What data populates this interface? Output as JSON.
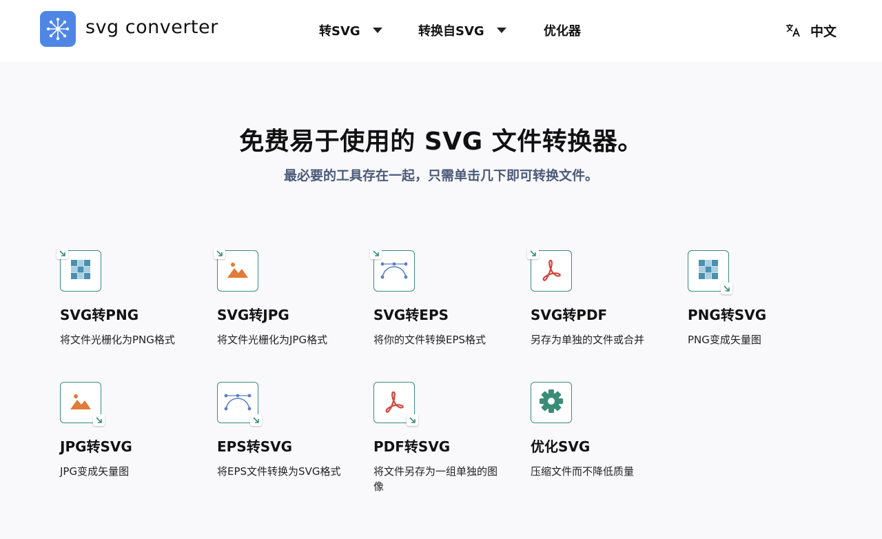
{
  "header": {
    "brand": "svg converter",
    "nav": [
      {
        "label": "转SVG",
        "has_dropdown": true
      },
      {
        "label": "转换自SVG",
        "has_dropdown": true
      },
      {
        "label": "优化器",
        "has_dropdown": false
      }
    ],
    "language": {
      "label": "中文",
      "icon": "translate-icon"
    }
  },
  "hero": {
    "title": "免费易于使用的 SVG 文件转换器。",
    "subtitle": "最必要的工具存在一起，只需单击几下即可转换文件。"
  },
  "colors": {
    "accent": "#3a8c77",
    "logo": "#4f86e6",
    "png_icon": "#4a90b0",
    "jpg_icon": "#e07b39",
    "eps_icon": "#5a7fc4",
    "pdf_icon": "#d0433a",
    "gear_icon": "#3a8c77"
  },
  "tools": [
    {
      "title": "SVG转PNG",
      "desc": "将文件光栅化为PNG格式",
      "icon": "checker-icon",
      "badge": "top-left"
    },
    {
      "title": "SVG转JPG",
      "desc": "将文件光栅化为JPG格式",
      "icon": "mountain-image-icon",
      "badge": "top-left"
    },
    {
      "title": "SVG转EPS",
      "desc": "将你的文件转换EPS格式",
      "icon": "bezier-curve-icon",
      "badge": "top-left"
    },
    {
      "title": "SVG转PDF",
      "desc": "另存为单独的文件或合并",
      "icon": "pdf-icon",
      "badge": "top-left"
    },
    {
      "title": "PNG转SVG",
      "desc": "PNG变成矢量图",
      "icon": "checker-icon",
      "badge": "bottom-right"
    },
    {
      "title": "JPG转SVG",
      "desc": "JPG变成矢量图",
      "icon": "mountain-image-icon",
      "badge": "bottom-right"
    },
    {
      "title": "EPS转SVG",
      "desc": "将EPS文件转换为SVG格式",
      "icon": "bezier-curve-icon",
      "badge": "bottom-right"
    },
    {
      "title": "PDF转SVG",
      "desc": "将文件另存为一组单独的图像",
      "icon": "pdf-icon",
      "badge": "bottom-right"
    },
    {
      "title": "优化SVG",
      "desc": "压缩文件而不降低质量",
      "icon": "gear-icon",
      "badge": "none"
    }
  ]
}
